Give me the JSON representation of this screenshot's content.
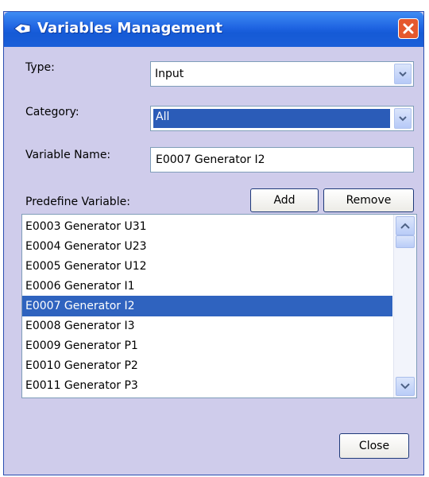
{
  "window": {
    "title": "Variables Management"
  },
  "type": {
    "label": "Type:",
    "value": "Input"
  },
  "category": {
    "label": "Category:",
    "value": "All"
  },
  "variable_name": {
    "label": "Variable Name:",
    "value": "E0007 Generator I2"
  },
  "predefine": {
    "label": "Predefine Variable:",
    "add_label": "Add",
    "remove_label": "Remove"
  },
  "list": {
    "items": [
      "E0003 Generator U31",
      "E0004 Generator U23",
      "E0005 Generator U12",
      "E0006 Generator I1",
      "E0007 Generator I2",
      "E0008 Generator I3",
      "E0009 Generator P1",
      "E0010 Generator P2",
      "E0011 Generator P3"
    ],
    "selected_index": 4
  },
  "footer": {
    "close_label": "Close"
  },
  "icons": {
    "title": "app-icon",
    "close": "close-icon",
    "dropdown": "chevron-down-icon",
    "scroll_up": "chevron-up-icon"
  },
  "colors": {
    "titlebar": "#1f64e2",
    "dialog_bg": "#cfcceb",
    "selection": "#2f63bf",
    "close": "#e5582d"
  }
}
